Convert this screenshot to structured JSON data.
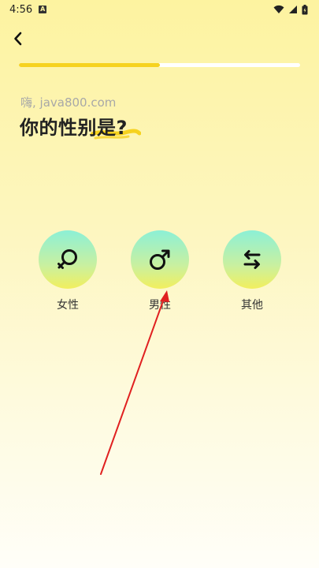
{
  "status_bar": {
    "time": "4:56",
    "notification_icon": "a-letter-icon",
    "icons": [
      "wifi-icon",
      "signal-icon",
      "battery-icon"
    ]
  },
  "nav": {
    "back_icon": "chevron-left-icon"
  },
  "progress": {
    "fraction": 0.5,
    "fill_color": "#f6d21f",
    "track_color": "#ffffff"
  },
  "greeting": "嗨, java800.com",
  "question": "你的性别是?",
  "options": [
    {
      "label": "女性",
      "icon": "female-symbol-icon"
    },
    {
      "label": "男性",
      "icon": "male-symbol-icon"
    },
    {
      "label": "其他",
      "icon": "swap-arrows-icon"
    }
  ],
  "colors": {
    "accent": "#f6d21f",
    "circle_top": "#8cf0d6",
    "circle_bottom": "#f2ef5e",
    "annotation_arrow": "#e02020"
  }
}
